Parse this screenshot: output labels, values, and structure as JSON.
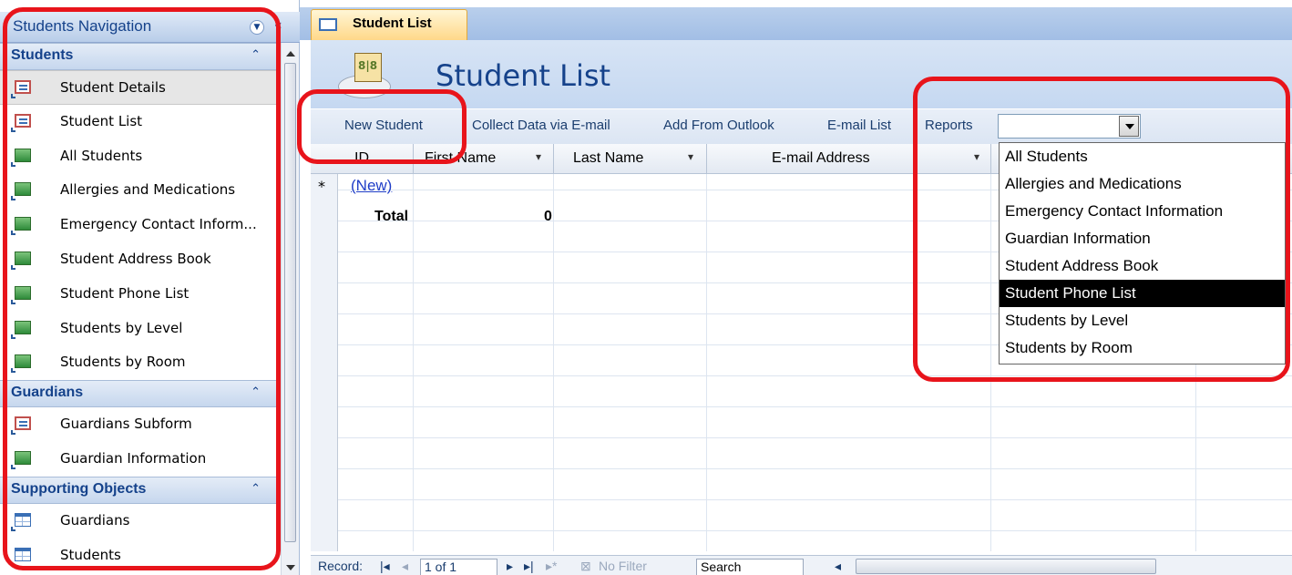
{
  "nav": {
    "title": "Students Navigation",
    "menu_icon": "chevron-down-icon",
    "collapse_icon": "double-chevron-left-icon",
    "groups": [
      {
        "label": "Students",
        "items": [
          {
            "label": "Student Details",
            "icon": "form-icon"
          },
          {
            "label": "Student List",
            "icon": "form-icon"
          },
          {
            "label": "All Students",
            "icon": "report-icon"
          },
          {
            "label": "Allergies and Medications",
            "icon": "report-icon"
          },
          {
            "label": "Emergency Contact Inform...",
            "icon": "report-icon"
          },
          {
            "label": "Student Address Book",
            "icon": "report-icon"
          },
          {
            "label": "Student Phone List",
            "icon": "report-icon"
          },
          {
            "label": "Students by Level",
            "icon": "report-icon"
          },
          {
            "label": "Students by Room",
            "icon": "report-icon"
          }
        ]
      },
      {
        "label": "Guardians",
        "items": [
          {
            "label": "Guardians Subform",
            "icon": "form-icon"
          },
          {
            "label": "Guardian Information",
            "icon": "report-icon"
          }
        ]
      },
      {
        "label": "Supporting Objects",
        "items": [
          {
            "label": "Guardians",
            "icon": "table-icon"
          },
          {
            "label": "Students",
            "icon": "table-icon"
          }
        ]
      }
    ]
  },
  "tab": {
    "label": "Student List"
  },
  "header": {
    "title": "Student List"
  },
  "commands": {
    "new_student": "New Student",
    "collect_data": "Collect Data via E-mail",
    "add_from_outlook": "Add From Outlook",
    "email_list": "E-mail List",
    "reports": "Reports"
  },
  "grid": {
    "columns": [
      "ID",
      "First Name",
      "Last Name",
      "E-mail Address"
    ],
    "new_row_marker": "*",
    "new_row_label": "(New)",
    "total_label": "Total",
    "total_value": "0"
  },
  "record_nav": {
    "record_label": "Record:",
    "position": "1 of 1",
    "filter_label": "No Filter",
    "search_label": "Search"
  },
  "reports_dropdown": {
    "value": "",
    "options": [
      "All Students",
      "Allergies and Medications",
      "Emergency Contact Information",
      "Guardian Information",
      "Student Address Book",
      "Student Phone List",
      "Students by Level",
      "Students by Room"
    ],
    "highlighted": "Student Phone List"
  },
  "colors": {
    "accent": "#15428b",
    "annotation": "#e8141b",
    "tab_active": "#ffd889",
    "highlight": "#000000"
  }
}
